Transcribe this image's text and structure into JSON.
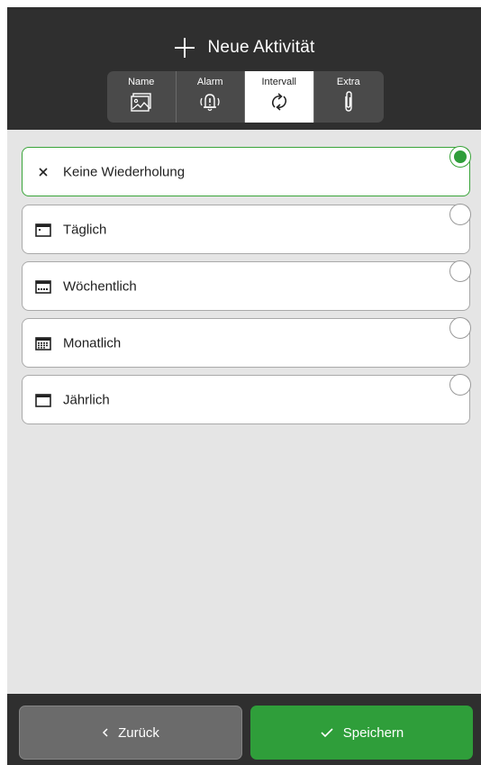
{
  "header": {
    "title": "Neue Aktivität",
    "title_icon": "plus-icon"
  },
  "tabs": [
    {
      "label": "Name",
      "icon": "image-icon",
      "active": false
    },
    {
      "label": "Alarm",
      "icon": "bell-alert-icon",
      "active": false
    },
    {
      "label": "Intervall",
      "icon": "repeat-icon",
      "active": true
    },
    {
      "label": "Extra",
      "icon": "paperclip-icon",
      "active": false
    }
  ],
  "options": [
    {
      "label": "Keine Wiederholung",
      "icon": "close-icon",
      "selected": true
    },
    {
      "label": "Täglich",
      "icon": "calendar-day-icon",
      "selected": false
    },
    {
      "label": "Wöchentlich",
      "icon": "calendar-week-icon",
      "selected": false
    },
    {
      "label": "Monatlich",
      "icon": "calendar-month-icon",
      "selected": false
    },
    {
      "label": "Jährlich",
      "icon": "calendar-year-icon",
      "selected": false
    }
  ],
  "footer": {
    "back_label": "Zurück",
    "save_label": "Speichern"
  },
  "colors": {
    "header_bg": "#2f2f2f",
    "content_bg": "#e5e5e5",
    "accent_green": "#2f9e3a",
    "back_button": "#6b6b6b"
  }
}
